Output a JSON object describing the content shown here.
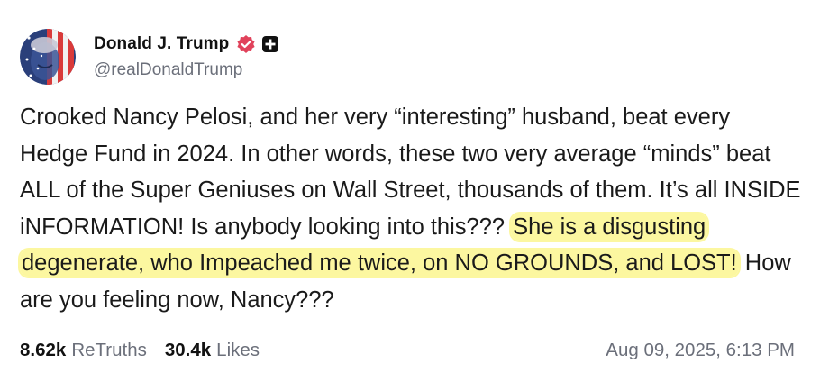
{
  "author": {
    "display_name": "Donald J. Trump",
    "handle": "@realDonaldTrump",
    "verified_icon": "verified-badge-icon",
    "verified_color": "#e1425b",
    "plus_icon": "plus-badge-icon"
  },
  "post": {
    "text_before": "Crooked Nancy Pelosi, and her very “interesting” husband, beat every Hedge Fund in 2024. In other words, these two very average “minds” beat ALL of the Super Geniuses on Wall Street, thousands of them. It’s all INSIDE iNFORMATION! Is anybody looking into this??? ",
    "text_highlighted": "She is a disgusting degenerate, who Impeached me twice, on NO GROUNDS, and LOST!",
    "text_after": " How are you feeling now, Nancy???",
    "highlight_color": "#fcf7a0"
  },
  "stats": {
    "retruths_count": "8.62k",
    "retruths_label": "ReTruths",
    "likes_count": "30.4k",
    "likes_label": "Likes"
  },
  "timestamp": "Aug 09, 2025, 6:13 PM"
}
